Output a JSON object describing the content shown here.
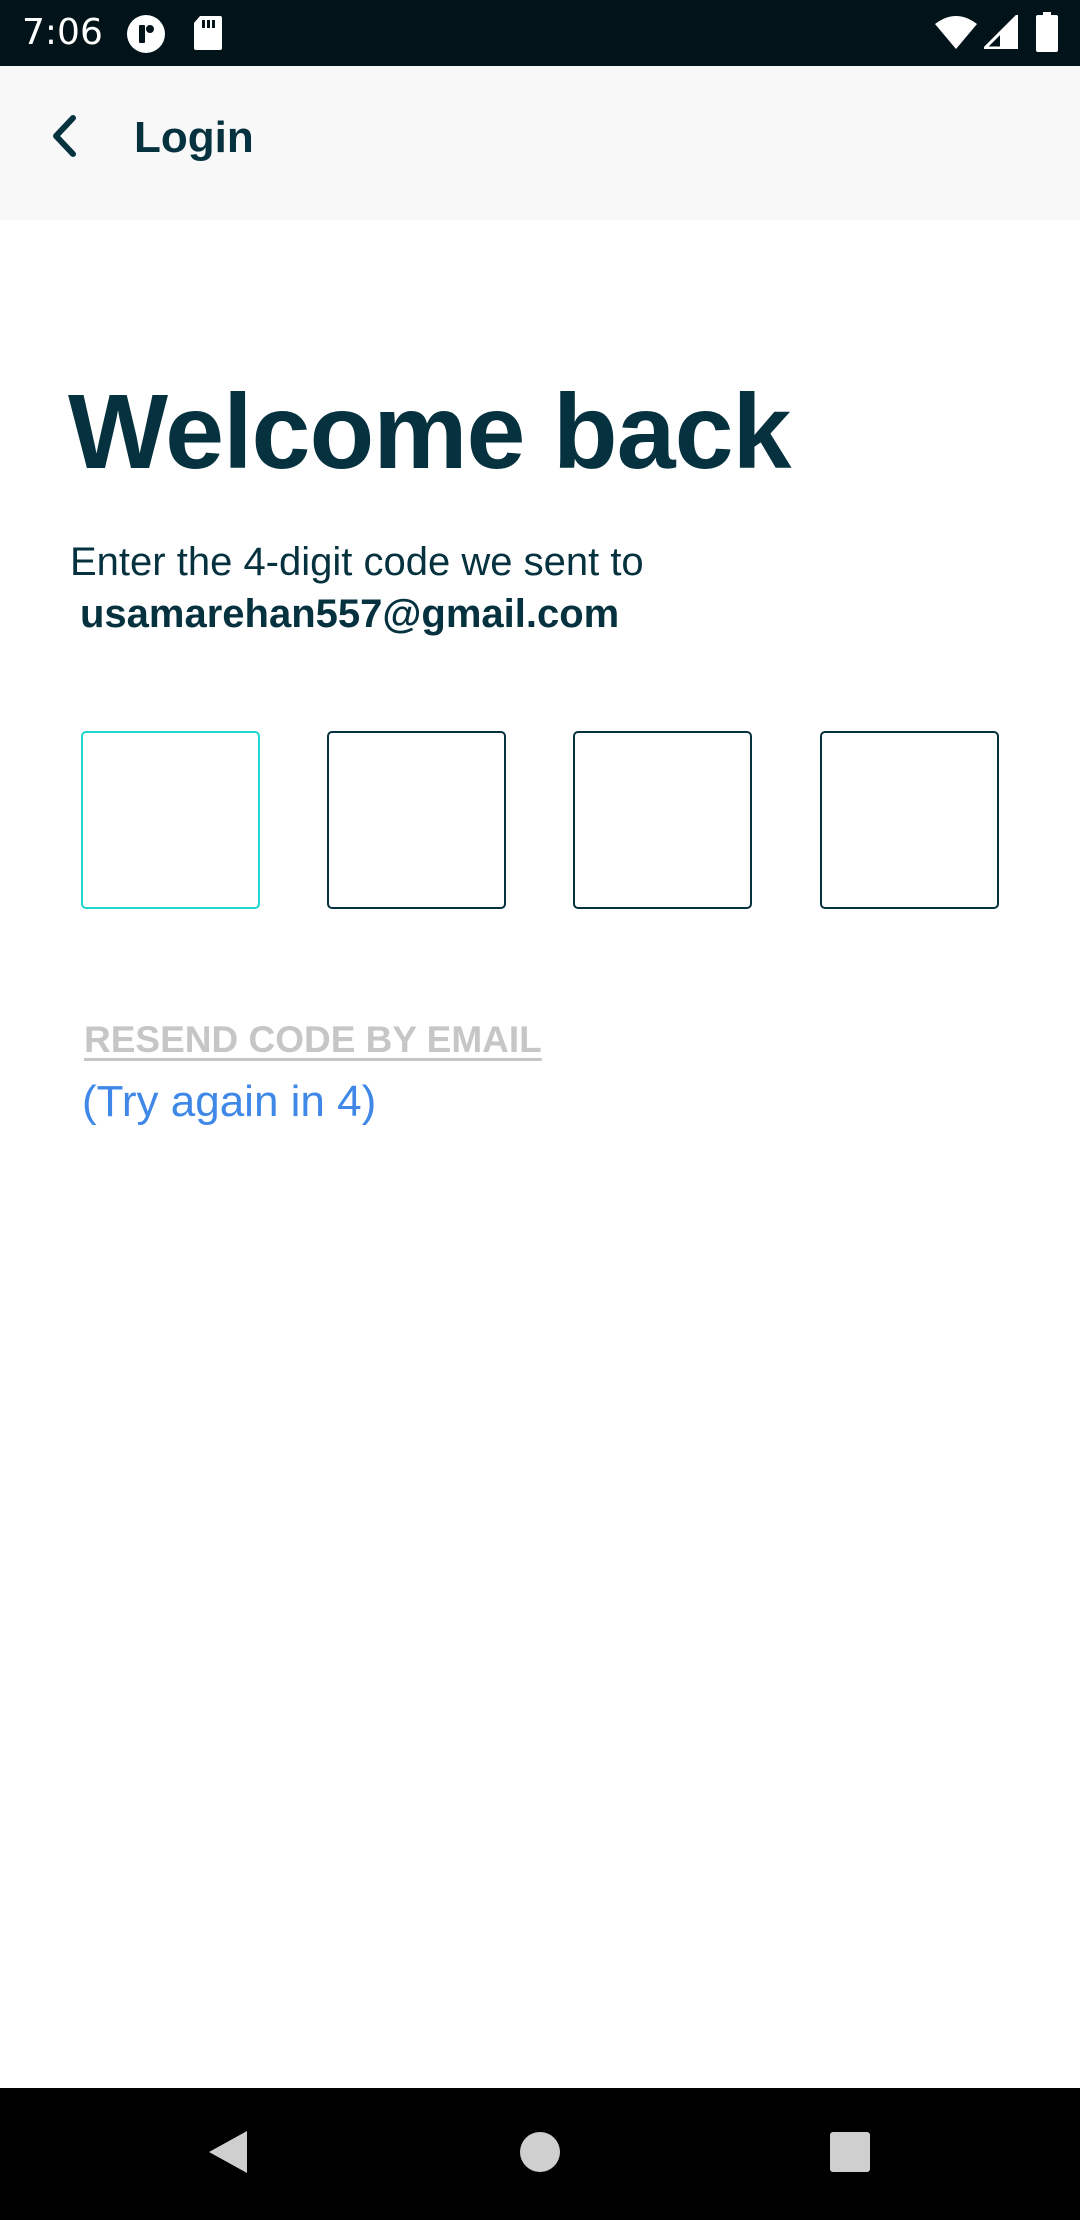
{
  "status_bar": {
    "time": "7:06",
    "icons": [
      "app-notification-icon",
      "sd-card-icon",
      "wifi-icon",
      "cell-signal-icon",
      "battery-icon"
    ]
  },
  "app_bar": {
    "back_icon": "chevron-left-icon",
    "title": "Login"
  },
  "main": {
    "headline": "Welcome back",
    "subtitle": "Enter the 4-digit code we sent to",
    "email": "usamarehan557@gmail.com",
    "code_inputs": [
      {
        "value": "",
        "focused": true
      },
      {
        "value": "",
        "focused": false
      },
      {
        "value": "",
        "focused": false
      },
      {
        "value": "",
        "focused": false
      }
    ],
    "resend_label": "RESEND CODE BY EMAIL",
    "retry_text": "(Try again in 4)"
  },
  "nav_bar": {
    "buttons": [
      "back-triangle-icon",
      "home-circle-icon",
      "recents-square-icon"
    ]
  },
  "colors": {
    "primary_text": "#06323f",
    "focus_border": "#1fd6d1",
    "disabled_link": "#c6c6c6",
    "countdown": "#3f88e8",
    "status_bar_bg": "#02141a",
    "app_bar_bg": "#f8f8f8"
  }
}
